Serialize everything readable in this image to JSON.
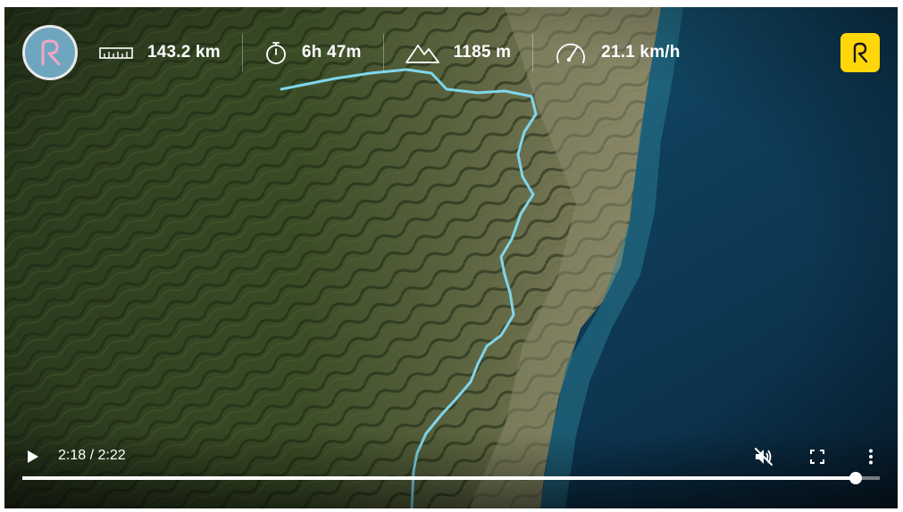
{
  "stats": {
    "distance": {
      "value": "143.2 km",
      "icon": "ruler-icon"
    },
    "duration": {
      "value": "6h 47m",
      "icon": "stopwatch-icon"
    },
    "elevation": {
      "value": "1185 m",
      "icon": "mountain-icon"
    },
    "speed": {
      "value": "21.1 km/h",
      "icon": "speedometer-icon"
    }
  },
  "player": {
    "current_time": "2:18",
    "separator": " / ",
    "duration": "2:22",
    "progress": 0.972,
    "muted": true
  },
  "colors": {
    "brand_yellow": "#ffd60a",
    "avatar_blue": "#6fa6bf",
    "route_cyan": "#7fd6ec"
  }
}
